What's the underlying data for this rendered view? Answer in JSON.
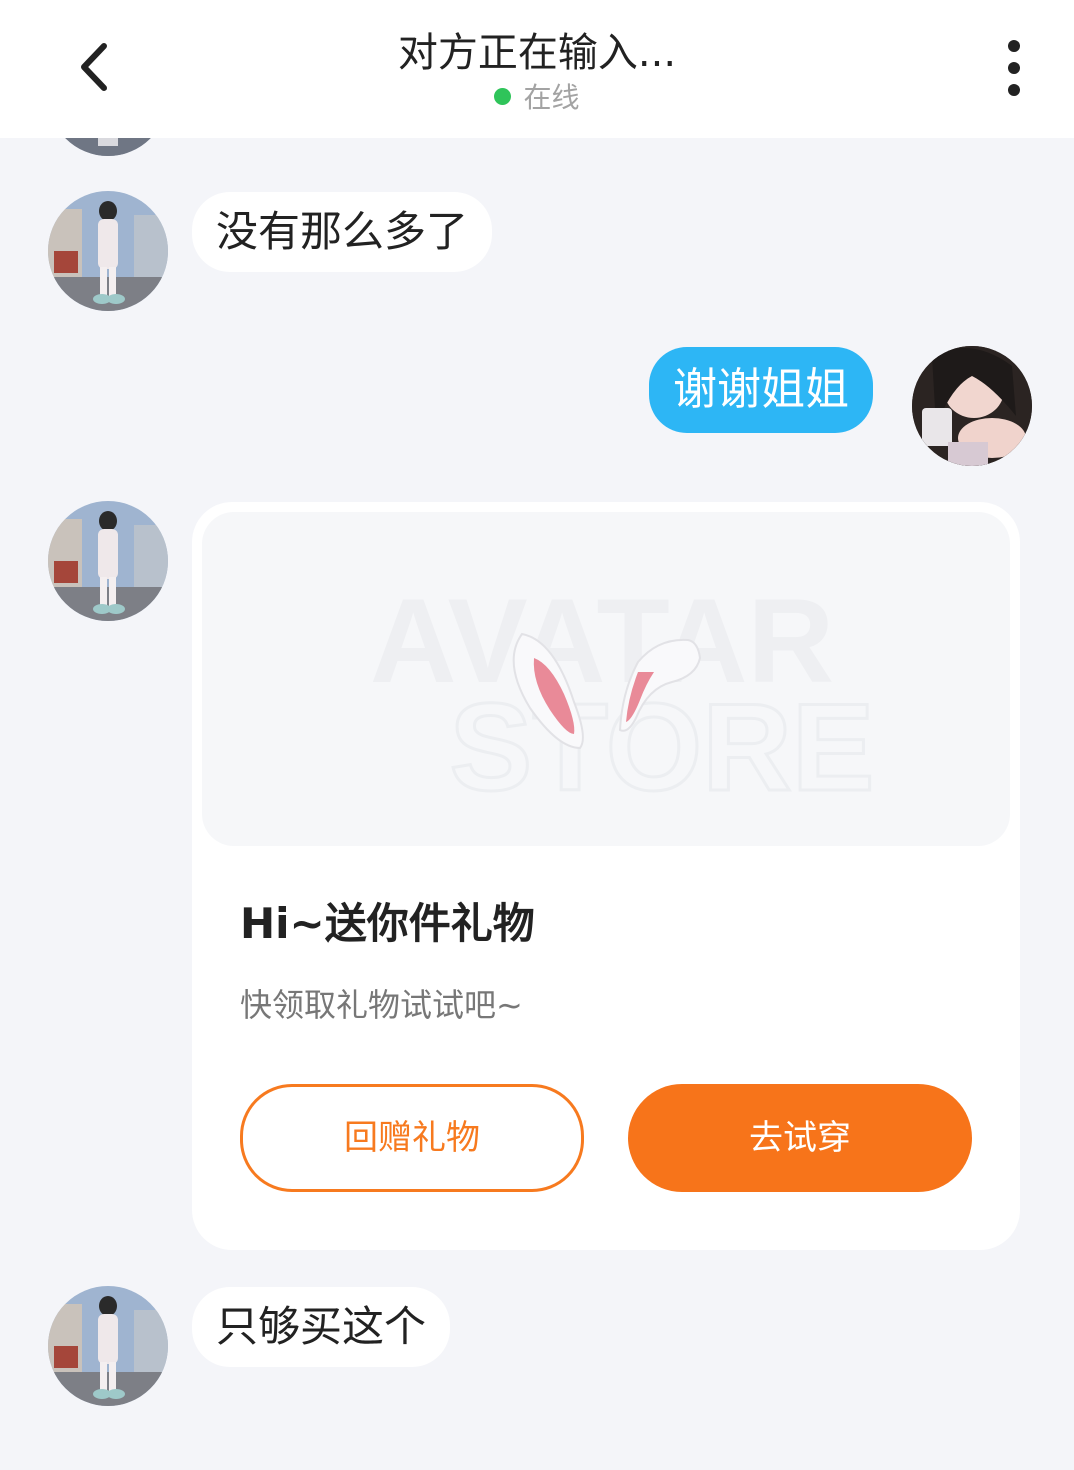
{
  "header": {
    "title": "对方正在输入...",
    "status": "在线",
    "back_icon": "chevron-left-icon",
    "more_icon": "more-vertical-icon"
  },
  "messages": [
    {
      "side": "incoming",
      "text": "没有那么多了"
    },
    {
      "side": "outgoing",
      "text": "谢谢姐姐"
    },
    {
      "side": "incoming",
      "type": "gift-card",
      "watermark_line1": "AVATAR",
      "watermark_line2": "STORE",
      "title": "Hi~送你件礼物",
      "subtitle": "快领取礼物试试吧~",
      "return_gift_label": "回赠礼物",
      "try_on_label": "去试穿"
    },
    {
      "side": "incoming",
      "text": "只够买这个"
    }
  ],
  "colors": {
    "accent_orange": "#f7741a",
    "outgoing_bubble": "#2db6f5",
    "online_dot": "#2fc45a",
    "background": "#f4f5f9"
  }
}
